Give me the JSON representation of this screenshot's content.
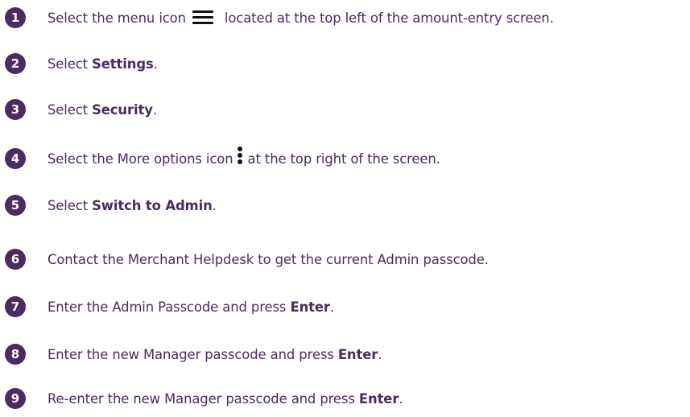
{
  "steps": [
    {
      "number": "1",
      "text_before": "Select the menu icon",
      "icon": "menu-icon",
      "text_after": "located at the top left of the amount-entry screen."
    },
    {
      "number": "2",
      "text_before": "Select ",
      "bold": "Settings",
      "text_after": "."
    },
    {
      "number": "3",
      "text_before": "Select ",
      "bold": "Security",
      "text_after": "."
    },
    {
      "number": "4",
      "text_before": "Select the More options icon",
      "icon": "more-options-icon",
      "text_after": "at the top right of the screen."
    },
    {
      "number": "5",
      "text_before": "Select ",
      "bold": "Switch to Admin",
      "text_after": "."
    },
    {
      "number": "6",
      "text": "Contact the Merchant Helpdesk to get the current Admin passcode."
    },
    {
      "number": "7",
      "text_before": "Enter the Admin Passcode and press ",
      "bold": "Enter",
      "text_after": "."
    },
    {
      "number": "8",
      "text_before": "Enter the new Manager passcode and press ",
      "bold": "Enter",
      "text_after": "."
    },
    {
      "number": "9",
      "text_before": "Re-enter the new Manager passcode and press ",
      "bold": "Enter",
      "text_after": "."
    }
  ],
  "colors": {
    "text": "#4a2c5e",
    "badge": "#4a2c5e",
    "icon": "#111111"
  }
}
